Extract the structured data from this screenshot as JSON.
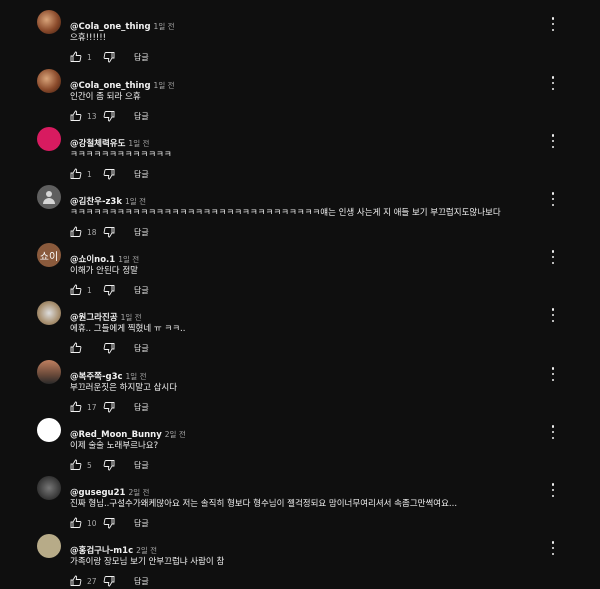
{
  "comments": [
    {
      "author": "@Cola_one_thing",
      "time": "1일 전",
      "text": "으휴!!!!!!",
      "likes": "1",
      "reply": "답글",
      "avatar_type": "photo"
    },
    {
      "author": "@Cola_one_thing",
      "time": "1일 전",
      "text": "인간이 좀 되라 으휴",
      "likes": "13",
      "reply": "답글",
      "avatar_type": "photo"
    },
    {
      "author": "@강철체력유도",
      "time": "1일 전",
      "text": "ㅋㅋㅋㅋㅋㅋㅋㅋㅋㅋㅋㅋㅋ",
      "likes": "1",
      "reply": "답글",
      "avatar_type": "dot"
    },
    {
      "author": "@김찬우-z3k",
      "time": "1일 전",
      "text": "ㅋㅋㅋㅋㅋㅋㅋㅋㅋㅋㅋㅋㅋㅋㅋㅋㅋㅋㅋㅋㅋㅋㅋㅋㅋㅋㅋㅋㅋㅋㅋㅋ얘는 인생 사는게 지 애들 보기 부끄럽지도않나보다",
      "likes": "18",
      "reply": "답글",
      "avatar_type": "person"
    },
    {
      "author": "@쇼이no.1",
      "time": "1일 전",
      "text": "이해가 안된다 정말",
      "likes": "1",
      "reply": "답글",
      "avatar_type": "text",
      "avatar_text": "쇼이"
    },
    {
      "author": "@원그라진공",
      "time": "1일 전",
      "text": "에휴.. 그들에게 찍혔네 ㅠ ㅋㅋ..",
      "likes": "",
      "reply": "답글",
      "avatar_type": "photo"
    },
    {
      "author": "@복주쪽-g3c",
      "time": "1일 전",
      "text": "부끄러운짓은 하지말고 삽시다",
      "likes": "17",
      "reply": "답글",
      "avatar_type": "photo"
    },
    {
      "author": "@Red_Moon_Bunny",
      "time": "2일 전",
      "text": "이제 술술 노래부르나요?",
      "likes": "5",
      "reply": "답글",
      "avatar_type": "photo"
    },
    {
      "author": "@gusegu21",
      "time": "2일 전",
      "text": "진짜 형님..구설수가왜케많아요 저는 솔직히 형보다 형수님이 젤걱정되요 맘이너무여리셔서 속좀그만썩여요...",
      "likes": "10",
      "reply": "답글",
      "avatar_type": "photo"
    },
    {
      "author": "@홍검구나-m1c",
      "time": "2일 전",
      "text": "가족이랑 장모님 보기 안부끄럽냐 사람이 참",
      "likes": "27",
      "reply": "답글",
      "avatar_type": "plain"
    }
  ],
  "icons": {
    "like": "thumb-up-icon",
    "dislike": "thumb-down-icon",
    "menu": "more-vert-icon"
  }
}
